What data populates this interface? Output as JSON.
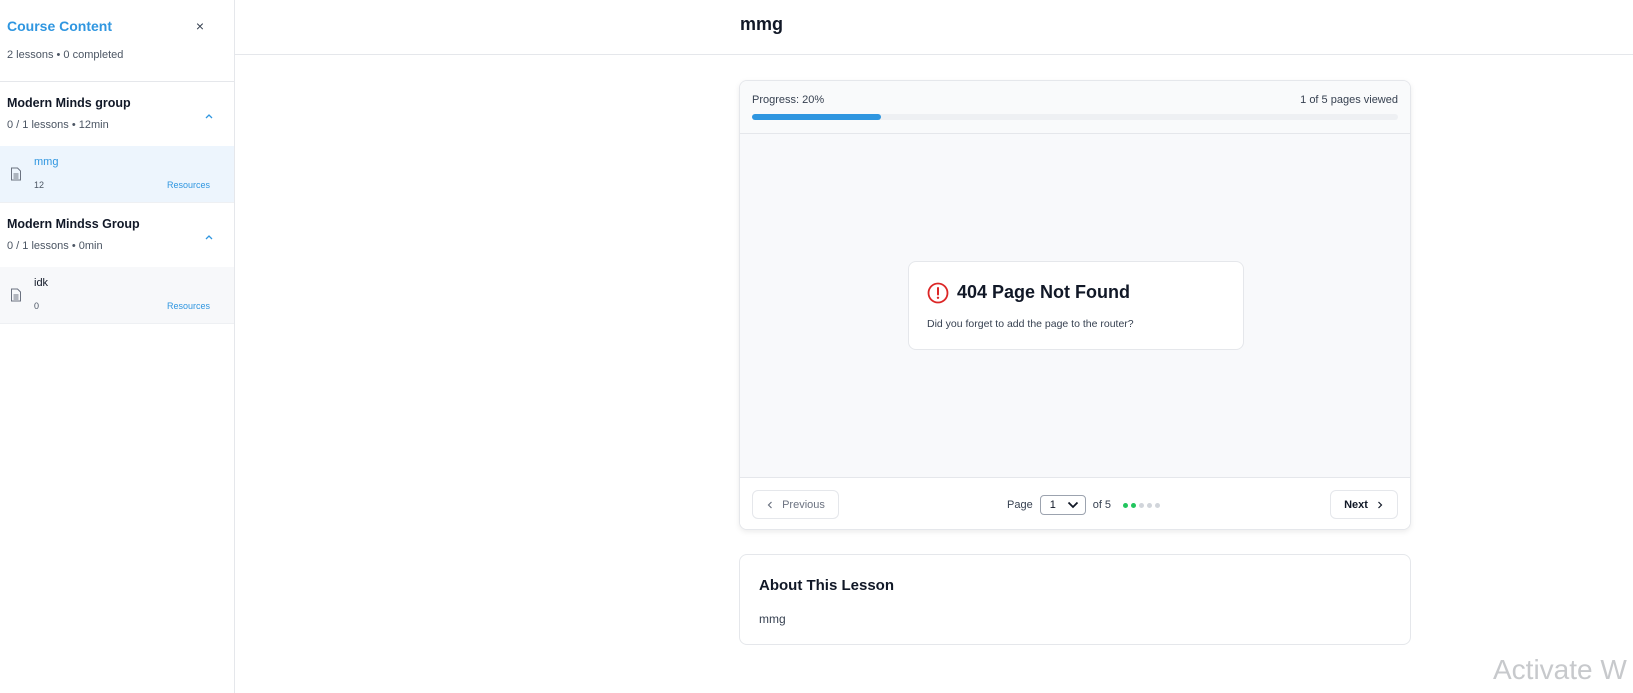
{
  "sidebar": {
    "title": "Course Content",
    "close_glyph": "×",
    "summary": "2 lessons • 0 completed",
    "groups": [
      {
        "title": "Modern Minds group",
        "meta": "0 / 1 lessons • 12min",
        "chevron_icon": "chevron-up-icon",
        "lessons": [
          {
            "title": "mmg",
            "count": "12",
            "resources_label": "Resources",
            "icon": "document-icon",
            "active": true
          }
        ]
      },
      {
        "title": "Modern Mindss Group",
        "meta": "0 / 1 lessons • 0min",
        "chevron_icon": "chevron-up-icon",
        "lessons": [
          {
            "title": "idk",
            "count": "0",
            "resources_label": "Resources",
            "icon": "document-icon",
            "active": false
          }
        ]
      }
    ]
  },
  "header": {
    "title": "mmg"
  },
  "viewer": {
    "progress_label": "Progress: 20%",
    "progress_fraction": 0.2,
    "pages_viewed": "1 of 5 pages viewed",
    "not_found": {
      "icon": "alert-circle-icon",
      "title": "404 Page Not Found",
      "message": "Did you forget to add the page to the router?"
    },
    "pager": {
      "prev_label": "Previous",
      "next_label": "Next",
      "page_label": "Page",
      "current_page": "1",
      "of_label": "of 5",
      "total_pages": 5,
      "dot_states": [
        "viewed",
        "current",
        "unviewed",
        "unviewed",
        "unviewed"
      ]
    }
  },
  "about": {
    "title": "About This Lesson",
    "text": "mmg"
  },
  "watermark": "Activate W",
  "colors": {
    "accent": "#2f96e0",
    "dot_viewed": "#22c55e",
    "dot_current": "#22c55e",
    "dot_unviewed": "#d1d5db",
    "error": "#dc2626"
  }
}
